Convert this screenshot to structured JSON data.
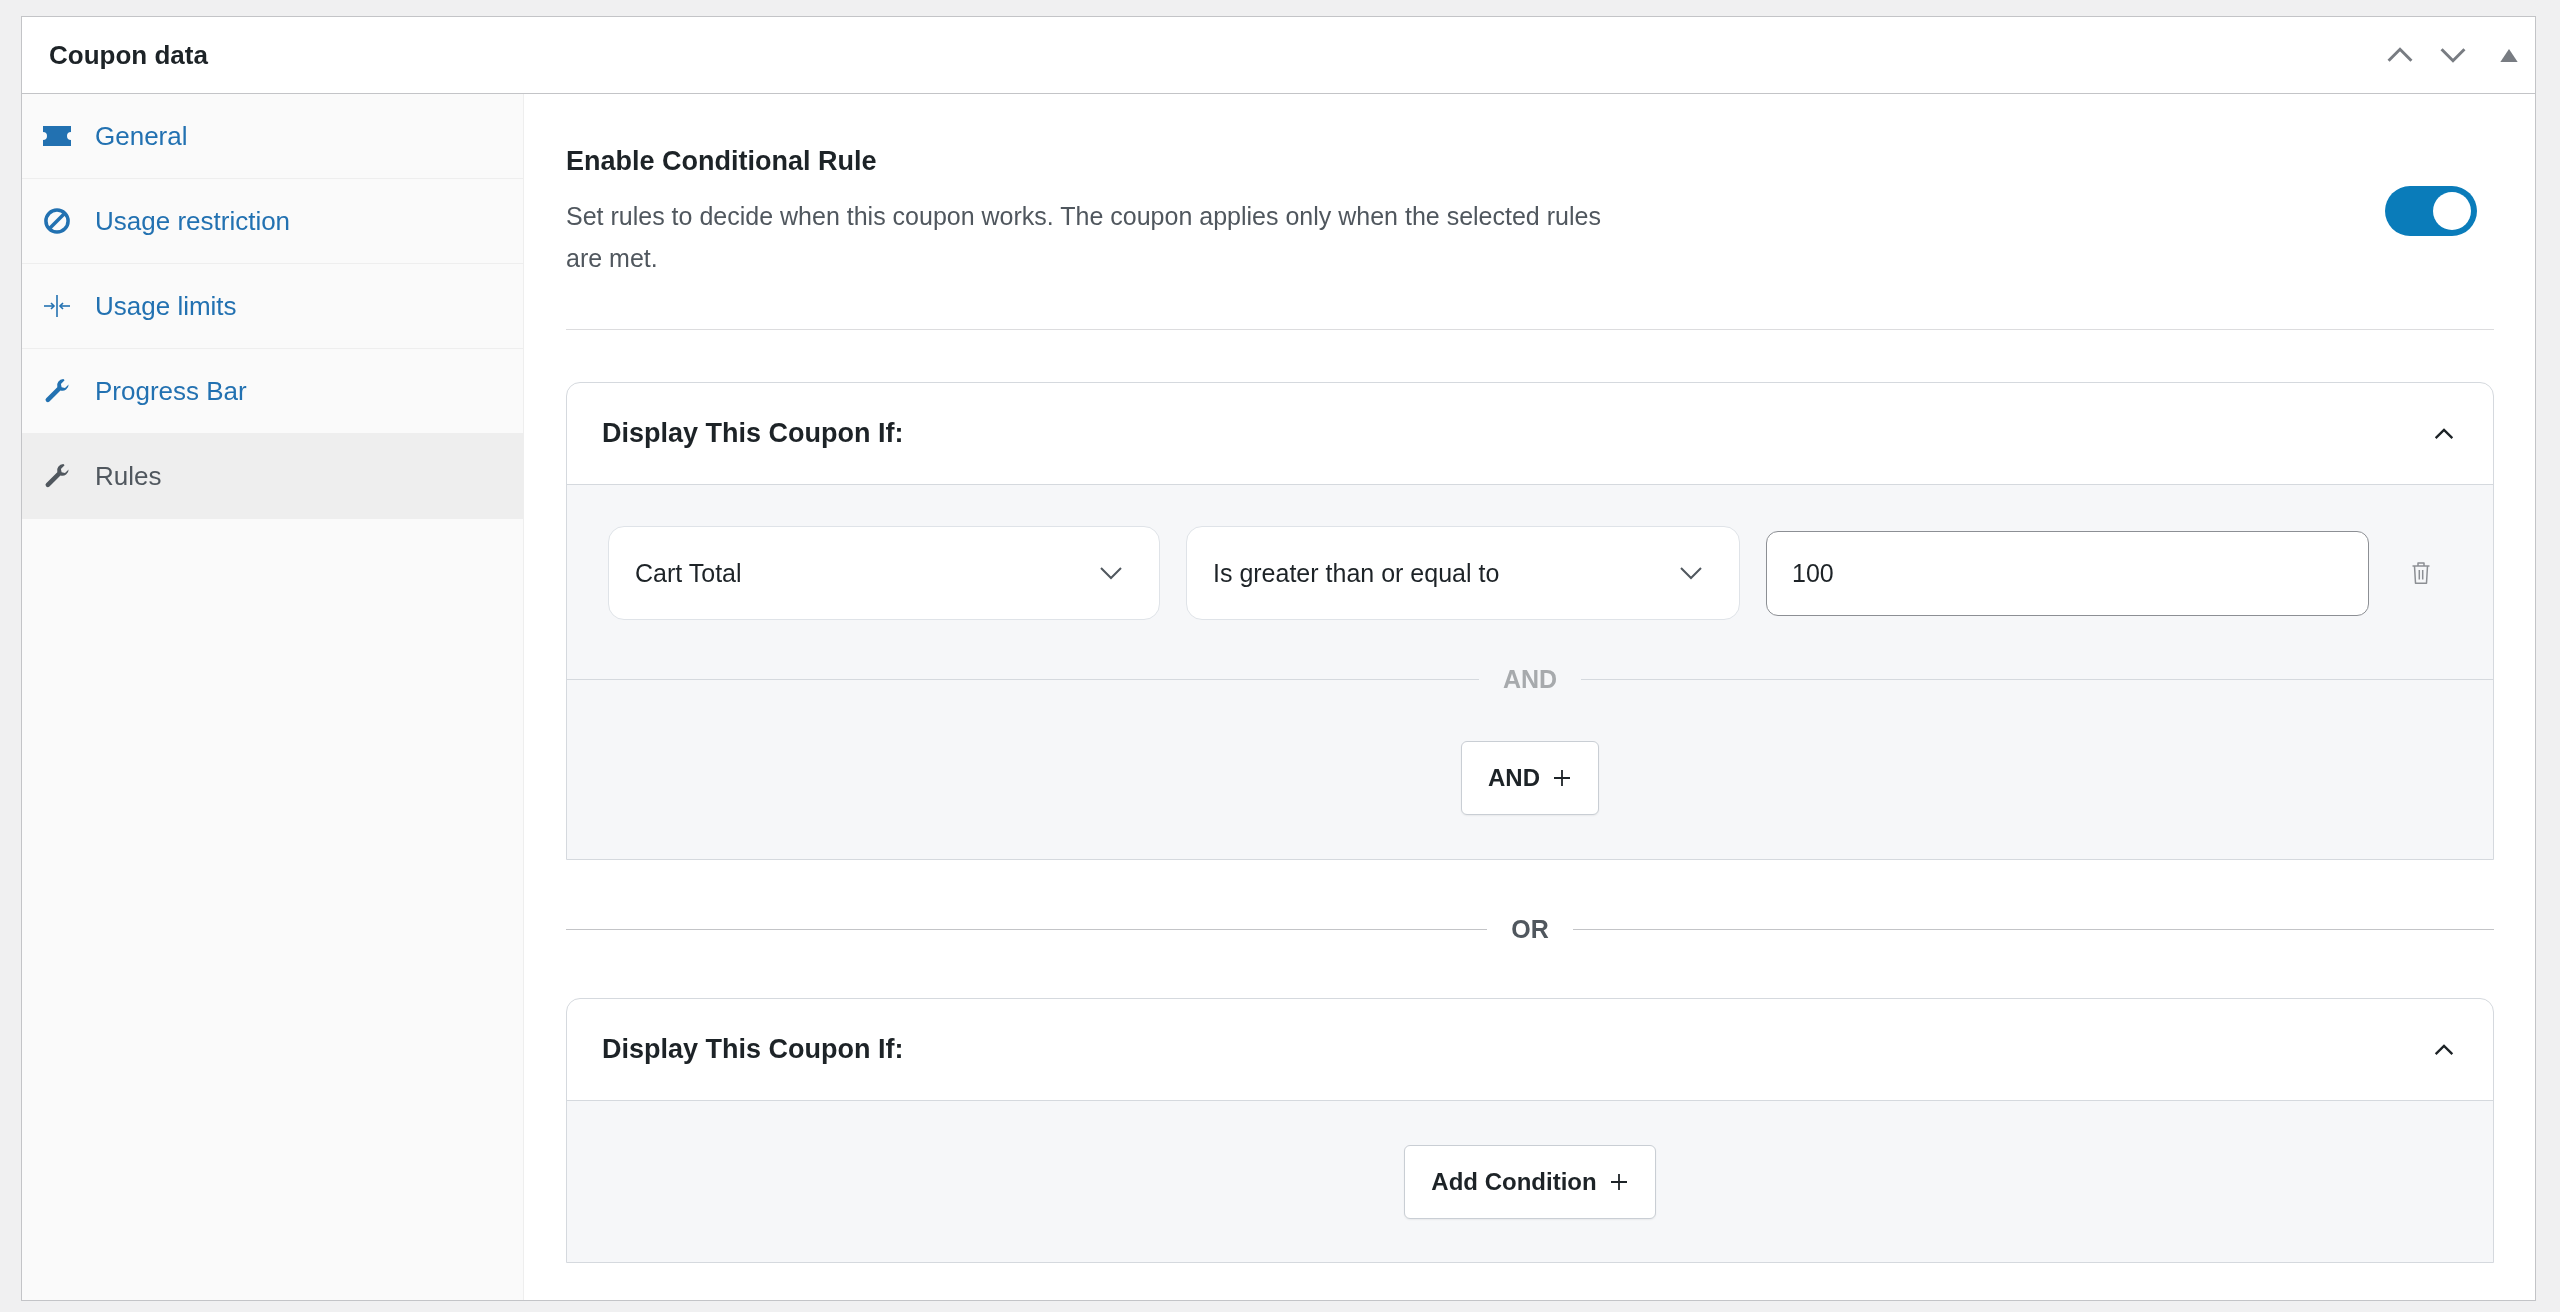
{
  "panel": {
    "title": "Coupon data"
  },
  "tabs": [
    {
      "label": "General",
      "selected": false
    },
    {
      "label": "Usage restriction",
      "selected": false
    },
    {
      "label": "Usage limits",
      "selected": false
    },
    {
      "label": "Progress Bar",
      "selected": false
    },
    {
      "label": "Rules",
      "selected": true
    }
  ],
  "rule": {
    "title": "Enable Conditional Rule",
    "description": "Set rules to decide when this coupon works. The coupon applies only when the selected rules are met.",
    "on": true
  },
  "groups": [
    {
      "title": "Display This Coupon If:",
      "expanded": true,
      "conditions": [
        {
          "field": "Cart Total",
          "operator": "Is greater than or equal to",
          "value": "100"
        }
      ],
      "joiner": "AND",
      "add_button": "AND"
    },
    {
      "title": "Display This Coupon If:",
      "expanded": true,
      "add_button": "Add Condition"
    }
  ],
  "group_separator": "OR"
}
